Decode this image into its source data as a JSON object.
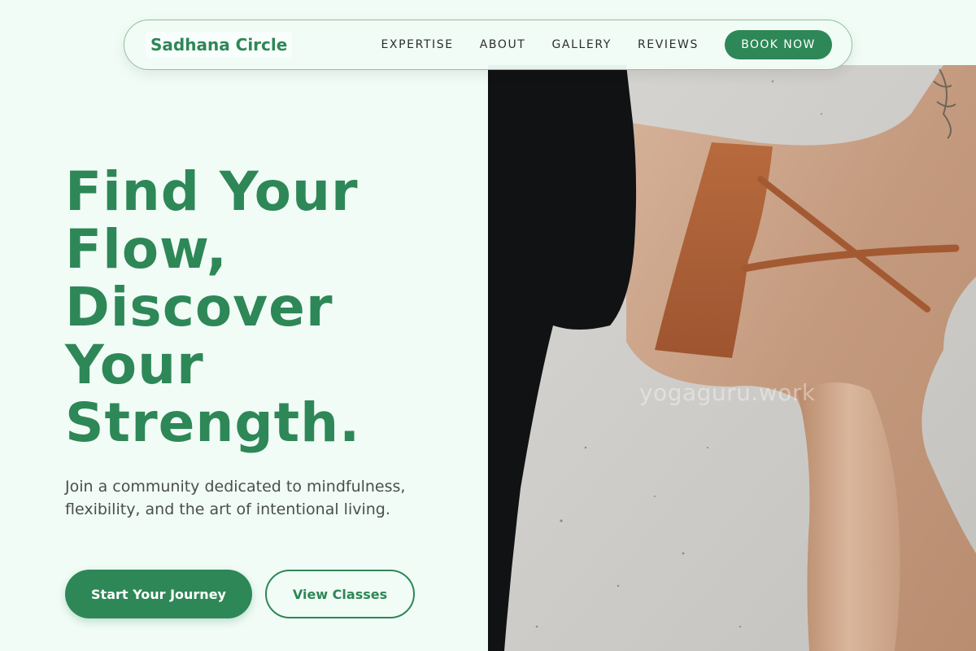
{
  "brand": {
    "name": "Sadhana Circle"
  },
  "nav": {
    "links": [
      "EXPERTISE",
      "ABOUT",
      "GALLERY",
      "REVIEWS"
    ],
    "cta": "BOOK NOW"
  },
  "hero": {
    "headline_lines": [
      "Find Your",
      "Flow,",
      "Discover",
      "Your",
      "Strength."
    ],
    "subtext": "Join a community dedicated to mindfulness, flexibility, and the art of intentional living.",
    "primary_cta": "Start Your Journey",
    "secondary_cta": "View Classes",
    "image": {
      "watermark": "yogaguru.work",
      "subject": "yoga pose, back view, rust sports bra"
    }
  },
  "colors": {
    "accent": "#2e8757",
    "background": "#f1fcf6",
    "text_muted": "#4a4f4c"
  }
}
